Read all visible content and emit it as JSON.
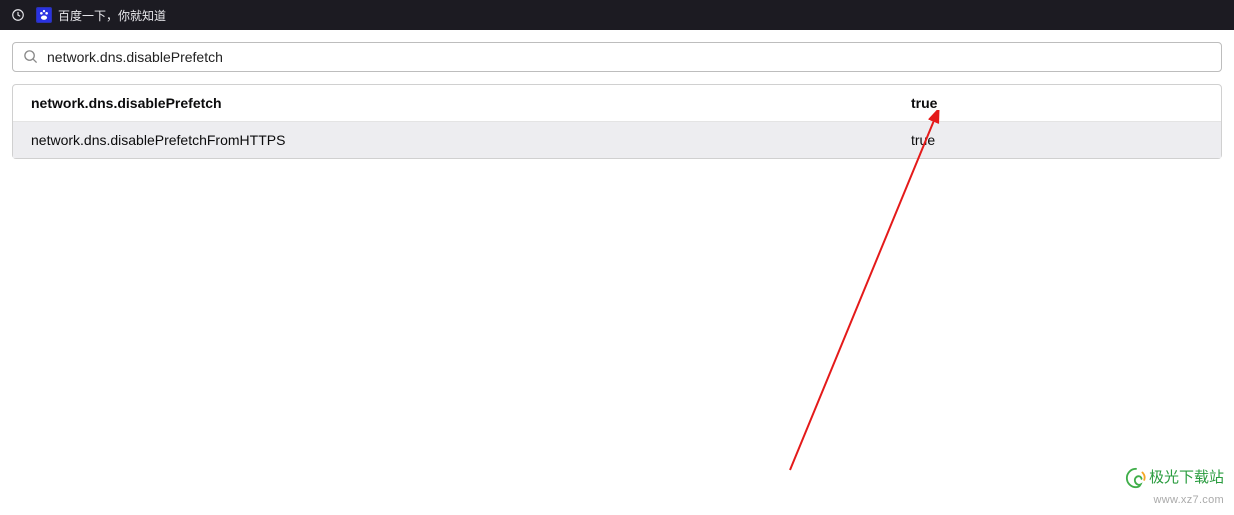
{
  "tab": {
    "title": "百度一下，你就知道",
    "favicon_label": "百"
  },
  "search": {
    "value": "network.dns.disablePrefetch"
  },
  "results": [
    {
      "name": "network.dns.disablePrefetch",
      "value": "true",
      "bold": true,
      "selected": false
    },
    {
      "name": "network.dns.disablePrefetchFromHTTPS",
      "value": "true",
      "bold": false,
      "selected": true
    }
  ],
  "watermark": {
    "text": "极光下载站",
    "url": "www.xz7.com"
  }
}
